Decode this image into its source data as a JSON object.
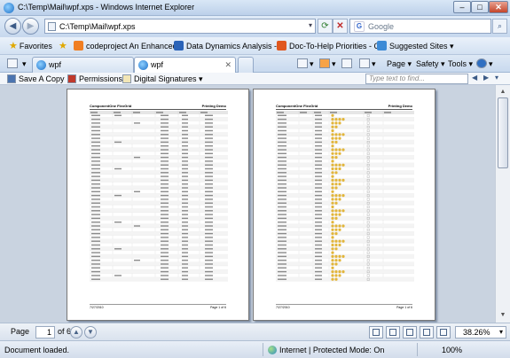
{
  "window": {
    "title": "C:\\Temp\\Mail\\wpf.xps - Windows Internet Explorer",
    "minimize": "–",
    "maximize": "□",
    "close": "✕"
  },
  "nav": {
    "address": "C:\\Temp\\Mail\\wpf.xps",
    "search_placeholder": "Google",
    "search_logo": "G"
  },
  "favorites": {
    "label": "Favorites",
    "items": [
      {
        "label": "codeproject An Enhanced...",
        "icon": "codeproject-icon",
        "color": "#f07e22"
      },
      {
        "label": "Data Dynamics Analysis - ...",
        "icon": "data-dynamics-icon",
        "color": "#2a63b8"
      },
      {
        "label": "Doc-To-Help Priorities - C...",
        "icon": "doc-to-help-icon",
        "color": "#e0571f"
      },
      {
        "label": "Suggested Sites ▾",
        "icon": "suggested-sites-icon",
        "color": "#3c8ad6"
      }
    ]
  },
  "tabs": [
    {
      "label": "wpf"
    },
    {
      "label": "wpf"
    }
  ],
  "tools": {
    "page": "Page ▾",
    "safety": "Safety ▾",
    "tools": "Tools ▾",
    "help": "▾"
  },
  "xps": {
    "save": "Save A Copy",
    "permissions": "Permissions",
    "signatures": "Digital Signatures ▾",
    "find_placeholder": "Type text to find..."
  },
  "pages": [
    {
      "title": "ComponentOne FlexGrid",
      "right": "Printing Demo",
      "footer_left": "7/27/2010",
      "footer_right": "Page 1 of 6"
    },
    {
      "title": "ComponentOne FlexGrid",
      "right": "Printing Demo",
      "footer_left": "7/27/2010",
      "footer_right": "Page 1 of 6"
    }
  ],
  "pagenav": {
    "label": "Page",
    "current": "1",
    "of": "of 6",
    "zoom": "38.26%"
  },
  "status": {
    "message": "Document loaded.",
    "zone": "Internet | Protected Mode: On",
    "zoom": "100%"
  },
  "colors": {
    "accent": "#3b5a86",
    "rating": "#e2b53a"
  }
}
